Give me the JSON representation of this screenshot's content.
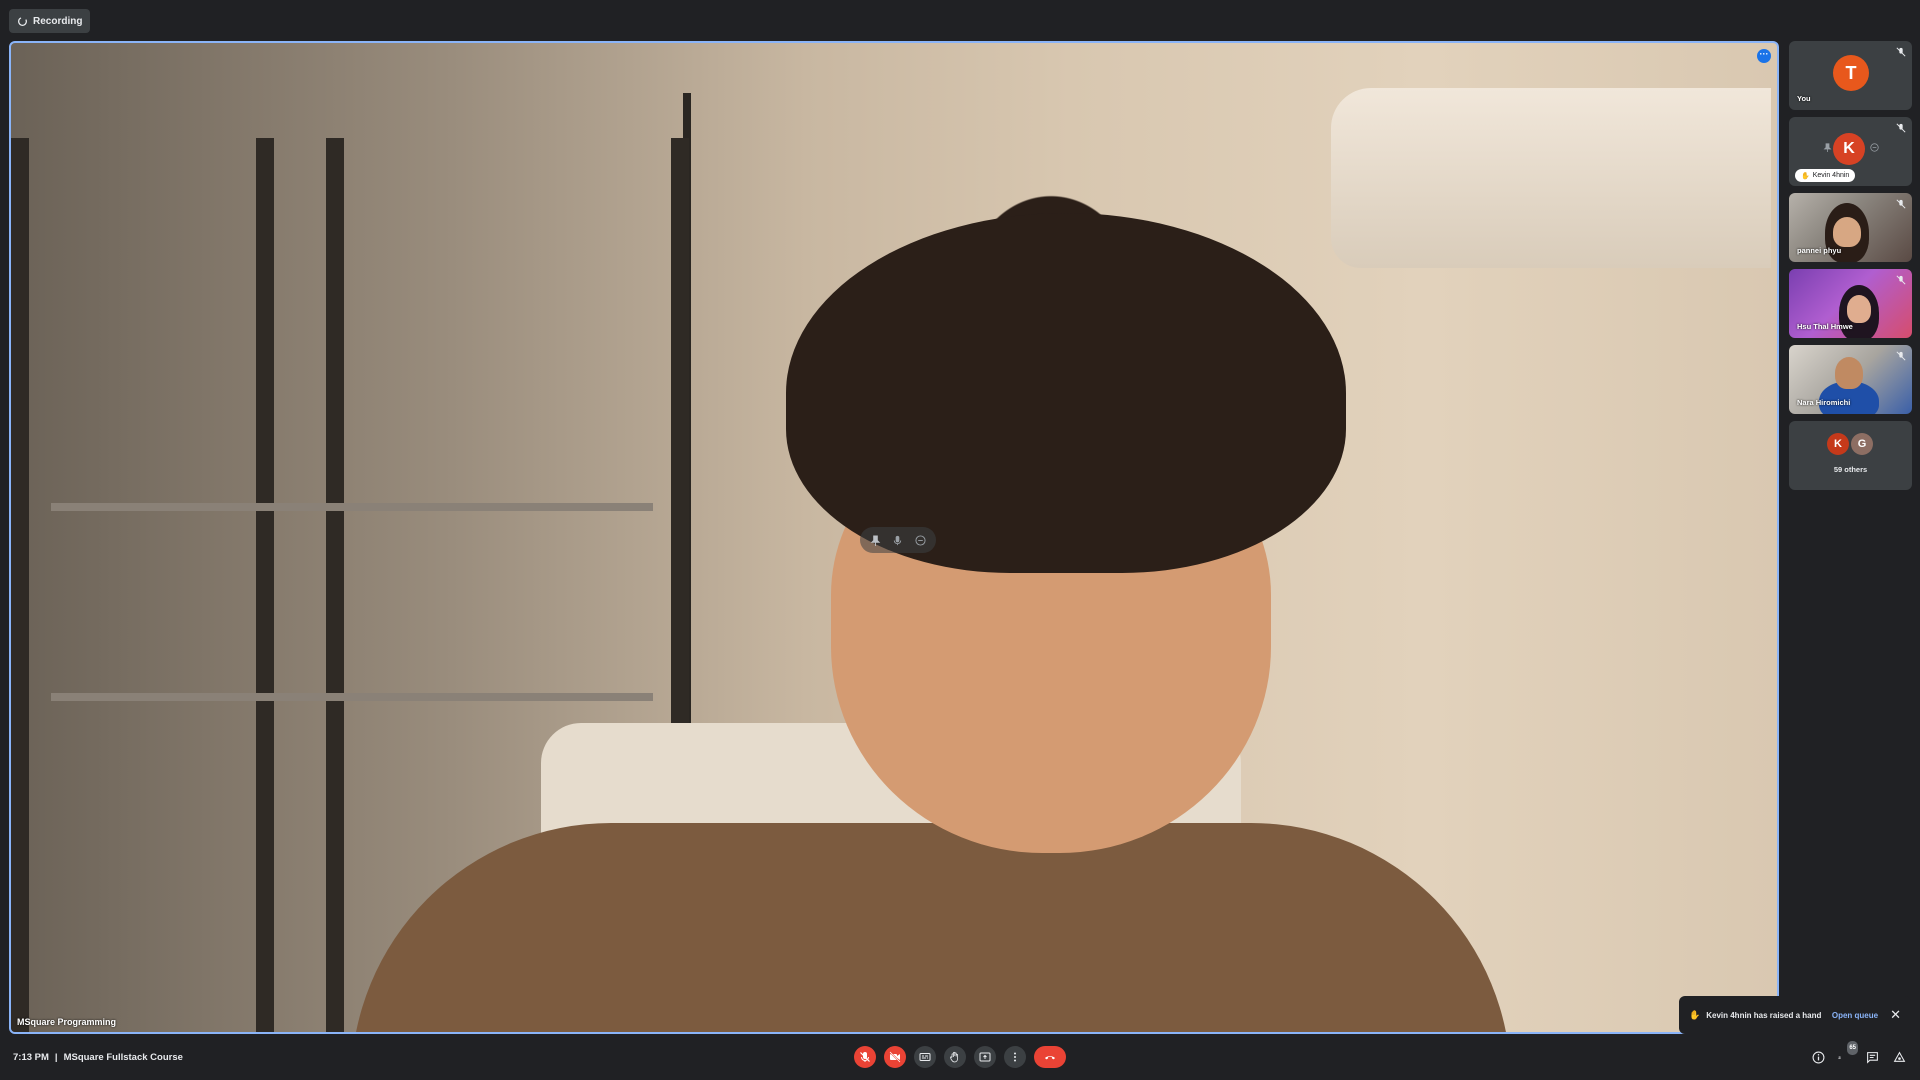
{
  "recording": {
    "label": "Recording"
  },
  "main": {
    "presenter_name": "MSquare Programming",
    "menu_icon": "more-horiz-icon",
    "hover_controls": [
      "pin-icon",
      "mic-icon",
      "remove-icon"
    ]
  },
  "participants": [
    {
      "name": "You",
      "initial": "T",
      "avatar_color": "#e8581c",
      "muted": true
    },
    {
      "name": "Kevin 4hnin",
      "initial": "K",
      "avatar_color": "#d74224",
      "muted": true,
      "hand_raised": true
    },
    {
      "name": "pannei phyu",
      "muted": true
    },
    {
      "name": "Hsu Thal Hmwe",
      "muted": true
    },
    {
      "name": "Nara Hiromichi",
      "muted": true
    }
  ],
  "others": {
    "label": "59 others",
    "initials": [
      "K",
      "G"
    ],
    "colors": [
      "#c5391a",
      "#8d6e63"
    ]
  },
  "notification": {
    "text": "Kevin 4hnin has raised a hand",
    "link": "Open queue"
  },
  "bottom_bar": {
    "time": "7:13 PM",
    "separator": "|",
    "meeting_title": "MSquare Fullstack Course",
    "controls": [
      "mic-off-icon",
      "camera-off-icon",
      "captions-icon",
      "raise-hand-icon",
      "present-icon",
      "more-vert-icon",
      "end-call-icon"
    ],
    "right_icons": [
      "info-icon",
      "people-icon",
      "chat-icon",
      "activities-icon"
    ],
    "people_count": "65"
  },
  "colors": {
    "accent": "#8ab4f8",
    "danger": "#ea4335",
    "background": "#202124"
  }
}
